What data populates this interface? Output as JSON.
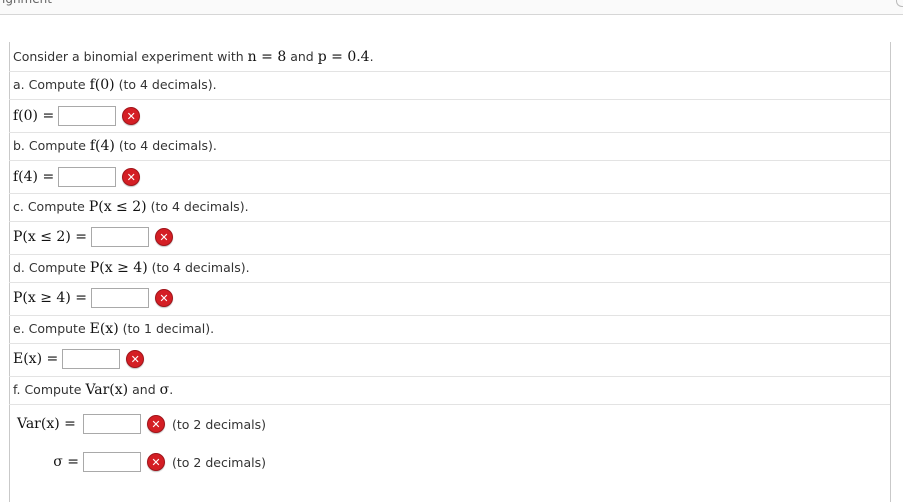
{
  "header": {
    "fragment": "ignment"
  },
  "intro": {
    "prefix": "Consider a binomial experiment with",
    "n_expr": "n = 8",
    "and": "and",
    "p_expr": "p = 0.4",
    "suffix": "."
  },
  "parts": {
    "a": {
      "label": "a. Compute",
      "math": "f(0)",
      "note": "(to 4 decimals).",
      "answer_lhs": "f(0) =",
      "value": "",
      "status": "incorrect"
    },
    "b": {
      "label": "b. Compute",
      "math": "f(4)",
      "note": "(to 4 decimals).",
      "answer_lhs": "f(4) =",
      "value": "",
      "status": "incorrect"
    },
    "c": {
      "label": "c. Compute",
      "math": "P(x ≤ 2)",
      "note": "(to 4 decimals).",
      "answer_lhs": "P(x ≤ 2) =",
      "value": "",
      "status": "incorrect"
    },
    "d": {
      "label": "d. Compute",
      "math": "P(x ≥ 4)",
      "note": "(to 4 decimals).",
      "answer_lhs": "P(x ≥ 4) =",
      "value": "",
      "status": "incorrect"
    },
    "e": {
      "label": "e. Compute",
      "math": "E(x)",
      "note": "(to 1 decimal).",
      "answer_lhs": "E(x) =",
      "value": "",
      "status": "incorrect"
    },
    "f": {
      "label": "f. Compute",
      "math": "Var(x)",
      "and": "and",
      "math2": "σ",
      "suffix": ".",
      "var_lhs": "Var(x) =",
      "var_value": "",
      "var_note": "(to 2 decimals)",
      "sigma_lhs": "σ =",
      "sigma_value": "",
      "sigma_note": "(to 2 decimals)",
      "status": "incorrect"
    }
  },
  "icons": {
    "incorrect": "x-circle-icon",
    "incorrect_color": "#d41e24"
  }
}
